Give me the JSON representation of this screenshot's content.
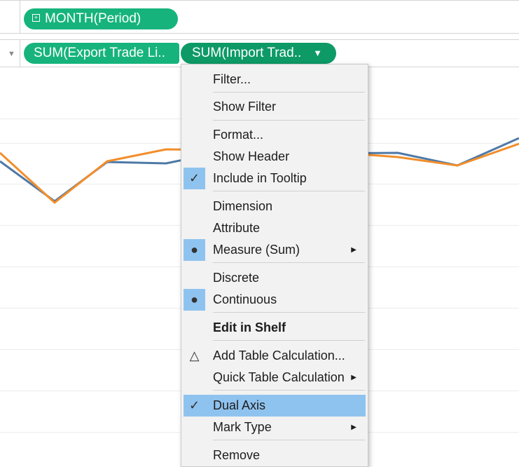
{
  "shelves": {
    "columns": {
      "pills": [
        {
          "label": "MONTH(Period)",
          "expand_icon": "plus-box-icon"
        }
      ]
    },
    "rows": {
      "dropdown_icon": "chevron-down-icon",
      "pills": [
        {
          "label": "SUM(Export Trade Li.."
        },
        {
          "label": "SUM(Import Trad..",
          "menu_icon": "caret-down-icon"
        }
      ]
    }
  },
  "chart_data": {
    "type": "line",
    "series": [
      {
        "color": "#4e79a7",
        "values": [
          230,
          287,
          231,
          233,
          214,
          219,
          218,
          236,
          197
        ]
      },
      {
        "color": "#f28e2b",
        "values": [
          218,
          289,
          230,
          213,
          214,
          216,
          224,
          236,
          205
        ]
      }
    ],
    "note_units": "vertical values are screen-independent chart estimates"
  },
  "context_menu": {
    "items": [
      {
        "id": "filter",
        "label": "Filter..."
      },
      {
        "id": "show-filter",
        "label": "Show Filter"
      },
      {
        "id": "format",
        "label": "Format..."
      },
      {
        "id": "show-header",
        "label": "Show Header"
      },
      {
        "id": "include-in-tooltip",
        "label": "Include in Tooltip",
        "state": "checked"
      },
      {
        "id": "dimension",
        "label": "Dimension"
      },
      {
        "id": "attribute",
        "label": "Attribute"
      },
      {
        "id": "measure-sum",
        "label": "Measure (Sum)",
        "state": "selected",
        "submenu": true
      },
      {
        "id": "discrete",
        "label": "Discrete"
      },
      {
        "id": "continuous",
        "label": "Continuous",
        "state": "selected"
      },
      {
        "id": "edit-in-shelf",
        "label": "Edit in Shelf",
        "bold": true
      },
      {
        "id": "add-table-calculation",
        "label": "Add Table Calculation...",
        "icon": "delta-icon"
      },
      {
        "id": "quick-table-calculation",
        "label": "Quick Table Calculation",
        "submenu": true
      },
      {
        "id": "dual-axis",
        "label": "Dual Axis",
        "state": "checked",
        "highlighted": true
      },
      {
        "id": "mark-type",
        "label": "Mark Type",
        "submenu": true
      },
      {
        "id": "remove",
        "label": "Remove"
      }
    ],
    "glyphs": {
      "check": "✓",
      "bullet": "●",
      "delta": "△",
      "submenu_arrow": "▶"
    }
  },
  "colors": {
    "pill_green": "#16b47c",
    "pill_active": "#0d9a67",
    "highlight": "#8fc3ef",
    "line_blue": "#4e79a7",
    "line_orange": "#f28e2b"
  }
}
